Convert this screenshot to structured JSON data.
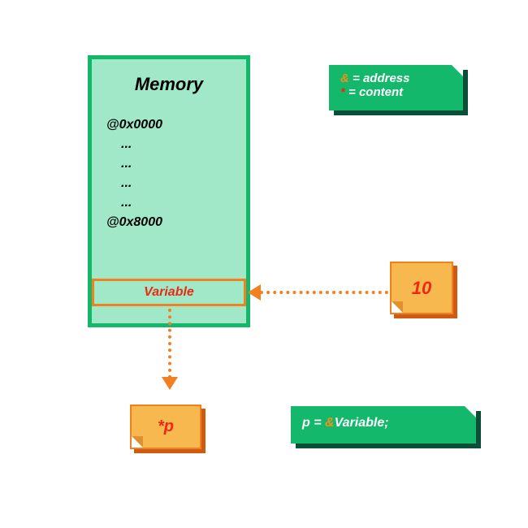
{
  "memory": {
    "title": "Memory",
    "addr_start": "@0x0000",
    "ellipsis": "...",
    "addr_var": "@0x8000",
    "variable_label": "Variable"
  },
  "legend": {
    "amp_symbol": "&",
    "amp_meaning": " = address",
    "star_symbol": "*",
    "star_meaning": " = content"
  },
  "value_card": {
    "value": "10"
  },
  "pointer_card": {
    "deref_expr": "*p"
  },
  "code_card": {
    "lhs": "p = ",
    "amp": "&",
    "rhs": "Variable;"
  }
}
